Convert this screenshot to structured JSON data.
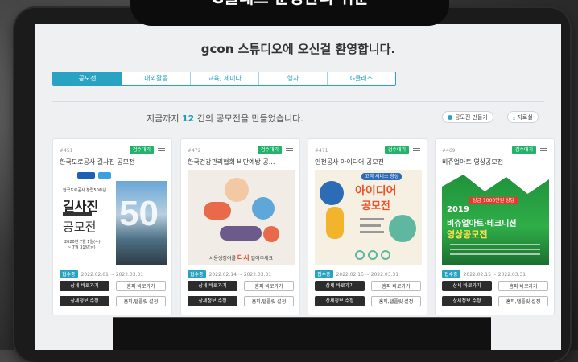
{
  "overlay_title": "G클래스 운영관리 쉬운",
  "header": {
    "title": "gcon 스튜디오에 오신걸 환영합니다."
  },
  "tabs": [
    {
      "label": "공모전"
    },
    {
      "label": "대외활동"
    },
    {
      "label": "교육, 세미나"
    },
    {
      "label": "행사"
    },
    {
      "label": "G클래스"
    }
  ],
  "summary": {
    "prefix": "지금까지 ",
    "count": "12",
    "suffix": " 건의 공모전을 만들었습니다."
  },
  "actions": {
    "create": "공모전 만들기",
    "files": "자료실"
  },
  "cards": [
    {
      "num": "#451",
      "badge": "검수대기",
      "title": "한국도로공사 길사진 공모전",
      "status": "접수중",
      "dates": "2022.02.01 ~ 2022.03.31",
      "btn_detail": "상세 바로가기",
      "btn_home": "홈피 바로가기",
      "btn_edit": "상세정보 수정",
      "btn_home_setting": "홈피,탭플릿 설정",
      "poster": {
        "line1": "길사진",
        "line2": "공모전",
        "sub": "한국도로공사 창립50주년",
        "date1": "2020년 7월 1일(수)",
        "date2": "~ 7월 31일(금)",
        "big": "50"
      }
    },
    {
      "num": "#472",
      "badge": "검수대기",
      "title": "한국건강관리협회 비만예방 공...",
      "status": "접수중",
      "dates": "2022.02.14 ~ 2022.03.31",
      "btn_detail": "상세 바로가기",
      "btn_home": "홈피 바로가기",
      "btn_edit": "상세정보 수정",
      "btn_home_setting": "홈피,탭플릿 설정",
      "poster": {
        "caption_pre": "시용생정어를 ",
        "caption_em": "다시",
        "caption_post": " 일어주세요"
      }
    },
    {
      "num": "#471",
      "badge": "검수대기",
      "title": "인천공사 아이디어 공모전",
      "status": "접수중",
      "dates": "2022.02.15 ~ 2022.03.31",
      "btn_detail": "상세 바로가기",
      "btn_home": "홈피 바로가기",
      "btn_edit": "상세정보 수정",
      "btn_home_setting": "홈피,탭플릿 설정",
      "poster": {
        "tag": "고객 서비스 향상",
        "line1": "아이디어",
        "line2": "공모전"
      }
    },
    {
      "num": "#469",
      "badge": "검수대기",
      "title": "비쥬얼아트 영상공모전",
      "status": "접수중",
      "dates": "2022.02.15 ~ 2022.03.31",
      "btn_detail": "상세 바로가기",
      "btn_home": "홈피 바로가기",
      "btn_edit": "상세정보 수정",
      "btn_home_setting": "홈피,탭플릿 설정",
      "poster": {
        "tag": "상금 1000만원 상당",
        "year": "2019",
        "line1": "비쥬얼아트·테크니션",
        "line2": "영상공모전"
      }
    }
  ]
}
